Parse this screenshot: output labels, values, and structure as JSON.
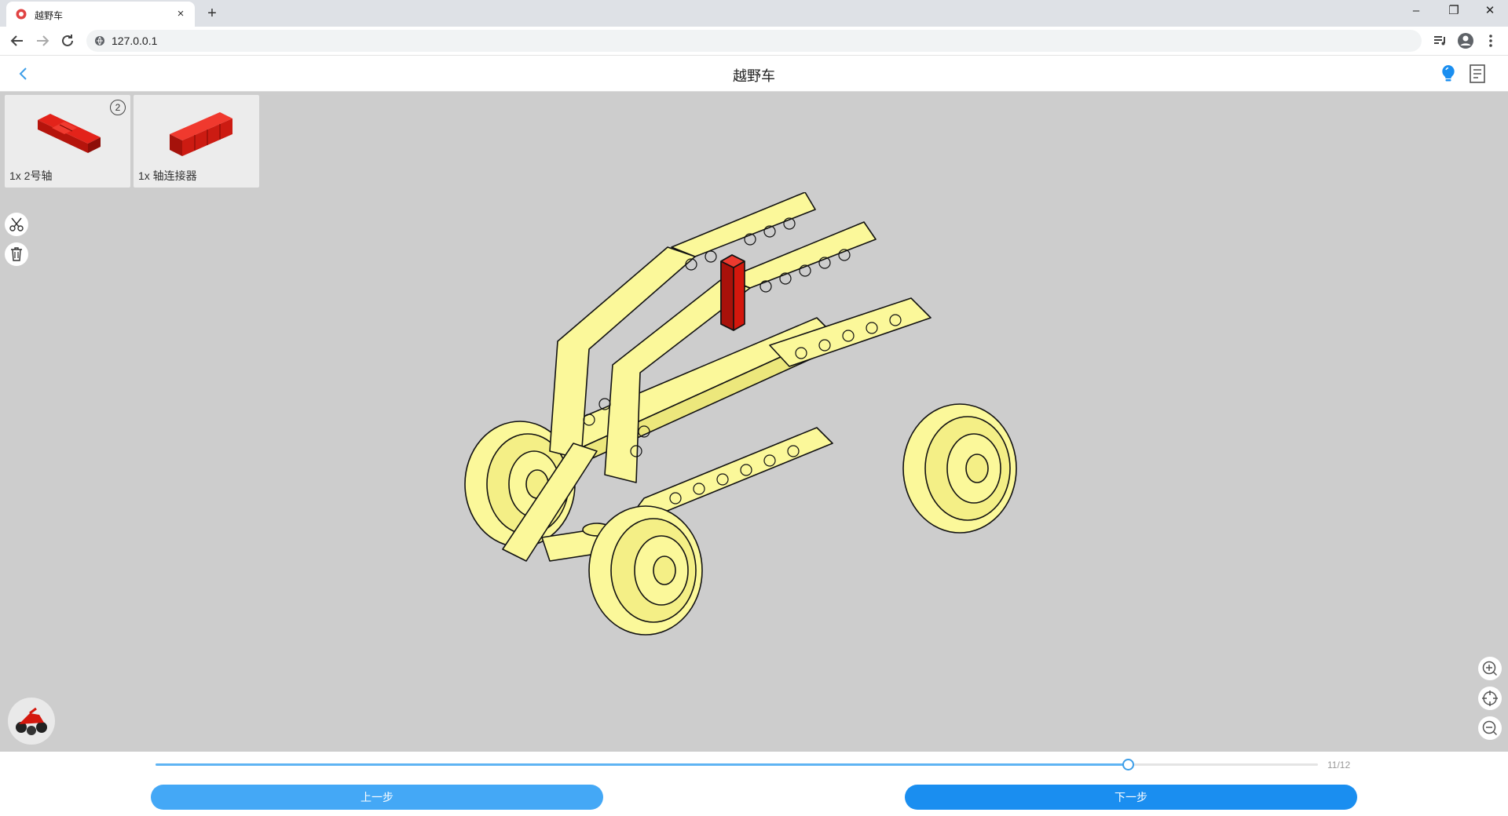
{
  "browser": {
    "tab_title": "越野车",
    "address": "127.0.0.1",
    "new_tab_label": "+",
    "tab_close_label": "×",
    "window_minimize": "–",
    "window_restore": "❐",
    "window_close": "✕"
  },
  "header": {
    "title": "越野车"
  },
  "parts": [
    {
      "label": "1x 2号轴",
      "badge": "2",
      "icon": "axle-2-icon"
    },
    {
      "label": "1x 轴连接器",
      "badge": "",
      "icon": "axle-connector-icon"
    }
  ],
  "side_tools": [
    "scissors-icon",
    "trash-icon"
  ],
  "zoom_tools": [
    "zoom-in-icon",
    "recenter-icon",
    "zoom-out-icon"
  ],
  "progress": {
    "current": 11,
    "total": 12,
    "label": "11/12"
  },
  "buttons": {
    "prev": "上一步",
    "next": "下一步"
  },
  "colors": {
    "accent": "#1a8ef0",
    "part_yellow": "#fbf89a",
    "part_red": "#d4170d",
    "canvas": "#cdcdcd"
  }
}
